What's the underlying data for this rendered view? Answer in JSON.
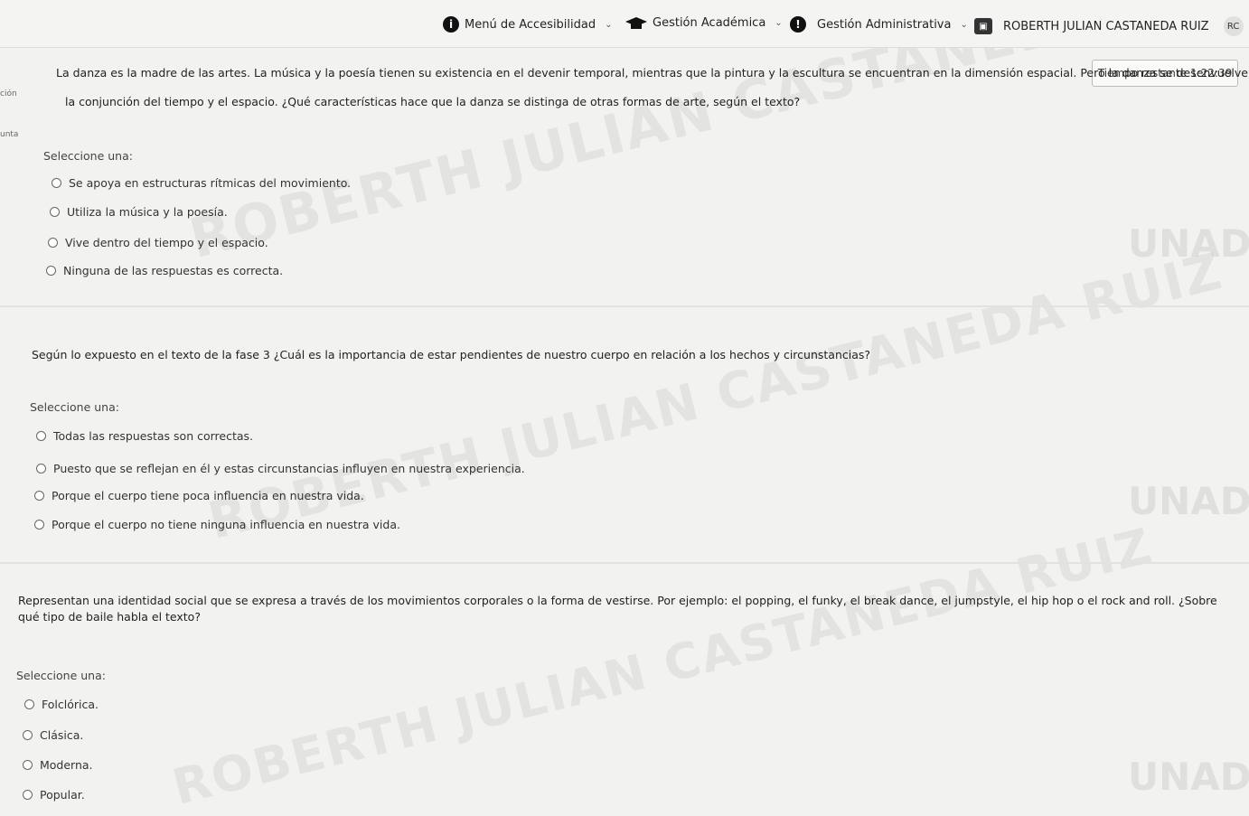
{
  "nav": {
    "accessibility": "Menú de Accesibilidad",
    "academic": "Gestión Académica",
    "admin": "Gestión Administrativa",
    "user": "ROBERTH JULIAN CASTANEDA RUIZ",
    "avatar": "RC"
  },
  "timer": {
    "label": "Tiempo restante",
    "value": "1:22:39"
  },
  "side": {
    "frag1": "ción",
    "frag2": "unta"
  },
  "q1": {
    "line1": "La danza es la madre de las artes. La música y la poesía tienen su existencia en el devenir temporal, mientras que la pintura y la escultura se encuentran en la dimensión espacial. Pero la danza se desenvuelve en",
    "line2": "la conjunción del tiempo y el espacio. ¿Qué características hace que la danza se distinga de otras formas de arte, según el texto?",
    "select": "Seleccione una:",
    "options": [
      "Se apoya en estructuras rítmicas del movimiento.",
      "Utiliza la música y la poesía.",
      "Vive dentro del tiempo y el espacio.",
      "Ninguna de las respuestas es correcta."
    ]
  },
  "q2": {
    "line1": "Según lo expuesto en el texto de la fase 3 ¿Cuál es la importancia de estar pendientes de nuestro cuerpo en relación a los hechos y circunstancias?",
    "select": "Seleccione una:",
    "options": [
      "Todas las respuestas son correctas.",
      "Puesto que se reflejan en él y estas circunstancias influyen en nuestra experiencia.",
      "Porque el cuerpo tiene poca influencia en nuestra vida.",
      "Porque el cuerpo no tiene ninguna influencia en nuestra vida."
    ]
  },
  "q3": {
    "line1": "Representan una identidad social que se expresa a través de los movimientos corporales o la forma de vestirse. Por ejemplo: el popping, el funky, el break dance, el jumpstyle, el hip hop o el rock and roll. ¿Sobre",
    "line2": "qué tipo de baile habla el texto?",
    "select": "Seleccione una:",
    "options": [
      "Folclórica.",
      "Clásica.",
      "Moderna.",
      "Popular."
    ]
  },
  "watermark": "ROBERTH JULIAN CASTANEDA RUIZ",
  "logo": "UNAD",
  "colors": {
    "background": "#f2f2f0",
    "text": "#222222",
    "nav_bg": "#f4f4f2"
  }
}
